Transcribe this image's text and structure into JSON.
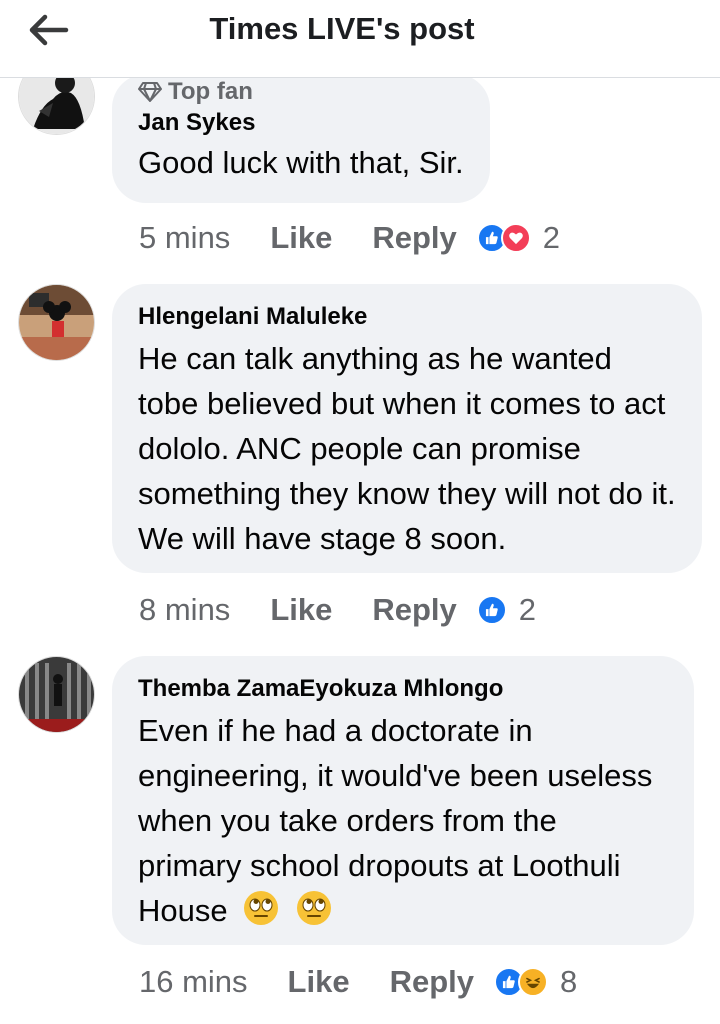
{
  "header": {
    "title": "Times LIVE's post",
    "back_icon": "arrow-left-icon"
  },
  "colors": {
    "like_blue": "#1877f2",
    "love_red": "#f33e58",
    "haha_yellow": "#f7b125",
    "bubble_bg": "#f0f2f5",
    "meta_grey": "#65676b"
  },
  "comments": [
    {
      "badge": "Top fan",
      "badge_icon": "diamond-icon",
      "author": "Jan Sykes",
      "text": "Good luck with that, Sir.",
      "time": "5 mins",
      "like_label": "Like",
      "reply_label": "Reply",
      "reactions": [
        "like",
        "love"
      ],
      "reaction_count": "2"
    },
    {
      "author": "Hlengelani Maluleke",
      "text": "He can talk anything as he wanted tobe believed but when it comes to act dololo. ANC people can promise something they know they will not do it. We will have stage 8 soon.",
      "time": "8 mins",
      "like_label": "Like",
      "reply_label": "Reply",
      "reactions": [
        "like"
      ],
      "reaction_count": "2"
    },
    {
      "author": "Themba ZamaEyokuza Mhlongo",
      "text": "Even if he had a doctorate in engineering, it would've been useless when you take orders from the primary school dropouts at Loothuli House",
      "text_emojis": [
        "face-with-rolling-eyes",
        "face-with-rolling-eyes"
      ],
      "time": "16 mins",
      "like_label": "Like",
      "reply_label": "Reply",
      "reactions": [
        "like",
        "haha"
      ],
      "reaction_count": "8"
    }
  ]
}
